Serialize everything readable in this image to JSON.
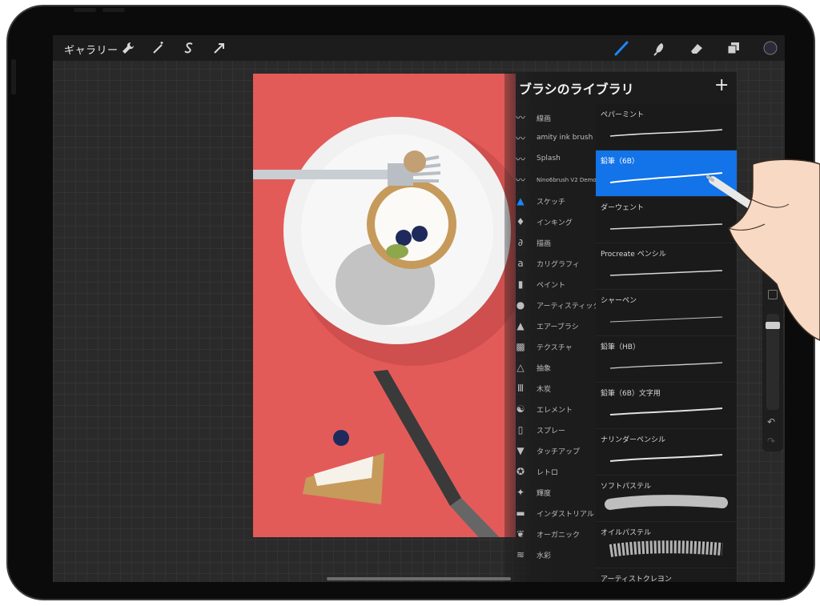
{
  "app": {
    "gallery_label": "ギャラリー",
    "colors": {
      "accent": "#1373e8",
      "panel_bg": "#1c1c1c",
      "canvas_photo_bg": "#e35b59"
    }
  },
  "toolbar": {
    "left_tools": [
      "wrench-icon",
      "magic-wand-icon",
      "selection-s-icon",
      "transform-arrow-icon"
    ],
    "right_tools": [
      "brush-icon",
      "smudge-icon",
      "eraser-icon",
      "layers-icon",
      "color-circle-icon"
    ]
  },
  "brush_library": {
    "title": "ブラシのライブラリ",
    "add_label": "+",
    "categories": [
      {
        "label": "線画",
        "icon": "stroke-icon"
      },
      {
        "label": "amity ink brush",
        "icon": "stroke-icon"
      },
      {
        "label": "Splash",
        "icon": "stroke-icon"
      },
      {
        "label": "Nino6brush V2 Demo...",
        "icon": "stroke-icon"
      },
      {
        "label": "スケッチ",
        "icon": "pencil-tip-icon"
      },
      {
        "label": "インキング",
        "icon": "ink-drop-icon"
      },
      {
        "label": "描画",
        "icon": "swirl-icon"
      },
      {
        "label": "カリグラフィ",
        "icon": "calligraphy-icon"
      },
      {
        "label": "ペイント",
        "icon": "paint-brush-icon"
      },
      {
        "label": "アーティスティック",
        "icon": "palette-icon"
      },
      {
        "label": "エアーブラシ",
        "icon": "airbrush-icon"
      },
      {
        "label": "テクスチャ",
        "icon": "texture-icon"
      },
      {
        "label": "抽象",
        "icon": "triangle-icon"
      },
      {
        "label": "木炭",
        "icon": "charcoal-icon"
      },
      {
        "label": "エレメント",
        "icon": "yin-yang-icon"
      },
      {
        "label": "スプレー",
        "icon": "spray-can-icon"
      },
      {
        "label": "タッチアップ",
        "icon": "touchup-icon"
      },
      {
        "label": "レトロ",
        "icon": "star-badge-icon"
      },
      {
        "label": "輝度",
        "icon": "sparkle-icon"
      },
      {
        "label": "インダストリアル",
        "icon": "anvil-icon"
      },
      {
        "label": "オーガニック",
        "icon": "leaf-icon"
      },
      {
        "label": "水彩",
        "icon": "waves-icon"
      }
    ],
    "brushes": [
      {
        "name": "ペパーミント",
        "selected": false
      },
      {
        "name": "鉛筆（6B）",
        "selected": true
      },
      {
        "name": "ダーウェント",
        "selected": false
      },
      {
        "name": "Procreate ペンシル",
        "selected": false
      },
      {
        "name": "シャーペン",
        "selected": false
      },
      {
        "name": "鉛筆（HB）",
        "selected": false
      },
      {
        "name": "鉛筆（6B）文字用",
        "selected": false
      },
      {
        "name": "ナリンダーペンシル",
        "selected": false
      },
      {
        "name": "ソフトパステル",
        "selected": false
      },
      {
        "name": "オイルパステル",
        "selected": false
      },
      {
        "name": "アーティストクレヨン",
        "selected": false
      }
    ]
  },
  "sidebar": {
    "undo_label": "↶",
    "redo_label": "↷"
  }
}
